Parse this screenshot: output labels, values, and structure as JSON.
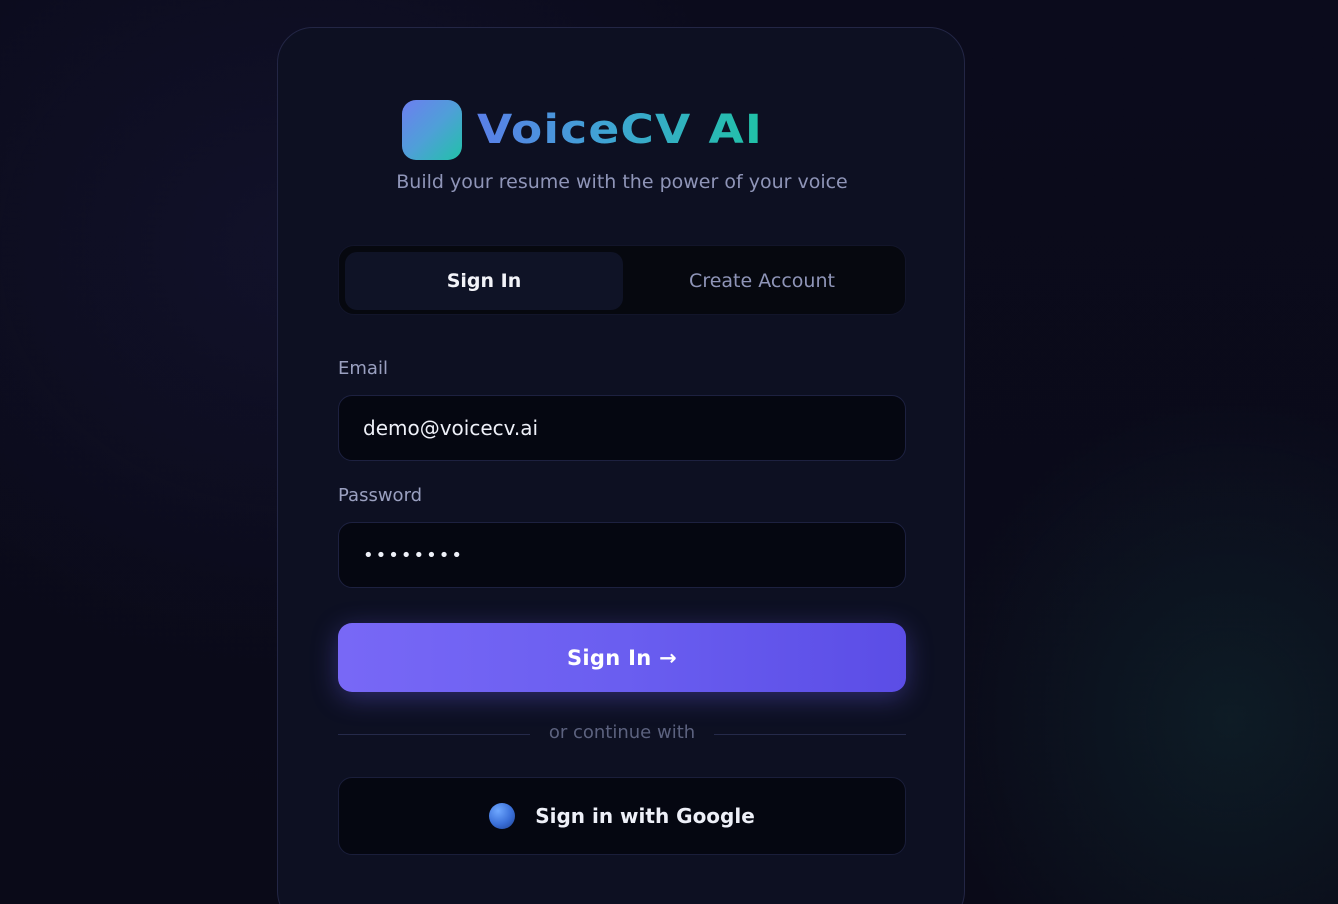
{
  "brand": {
    "name": "VoiceCV AI",
    "tagline": "Build your resume with the power of your voice"
  },
  "tabs": [
    {
      "label": "Sign In",
      "active": true
    },
    {
      "label": "Create Account",
      "active": false
    }
  ],
  "form": {
    "email_label": "Email",
    "email_value": "demo@voicecv.ai",
    "password_label": "Password",
    "password_value": "••••••••",
    "submit_label": "Sign In →"
  },
  "divider_text": "or continue with",
  "google": {
    "label": "Sign in with Google",
    "icon": "globe-icon"
  },
  "colors": {
    "accent": "#6a5ef0",
    "brand_gradient_start": "#5a7fe8",
    "brand_gradient_end": "#20c2a6",
    "background": "#0b0b1c"
  }
}
